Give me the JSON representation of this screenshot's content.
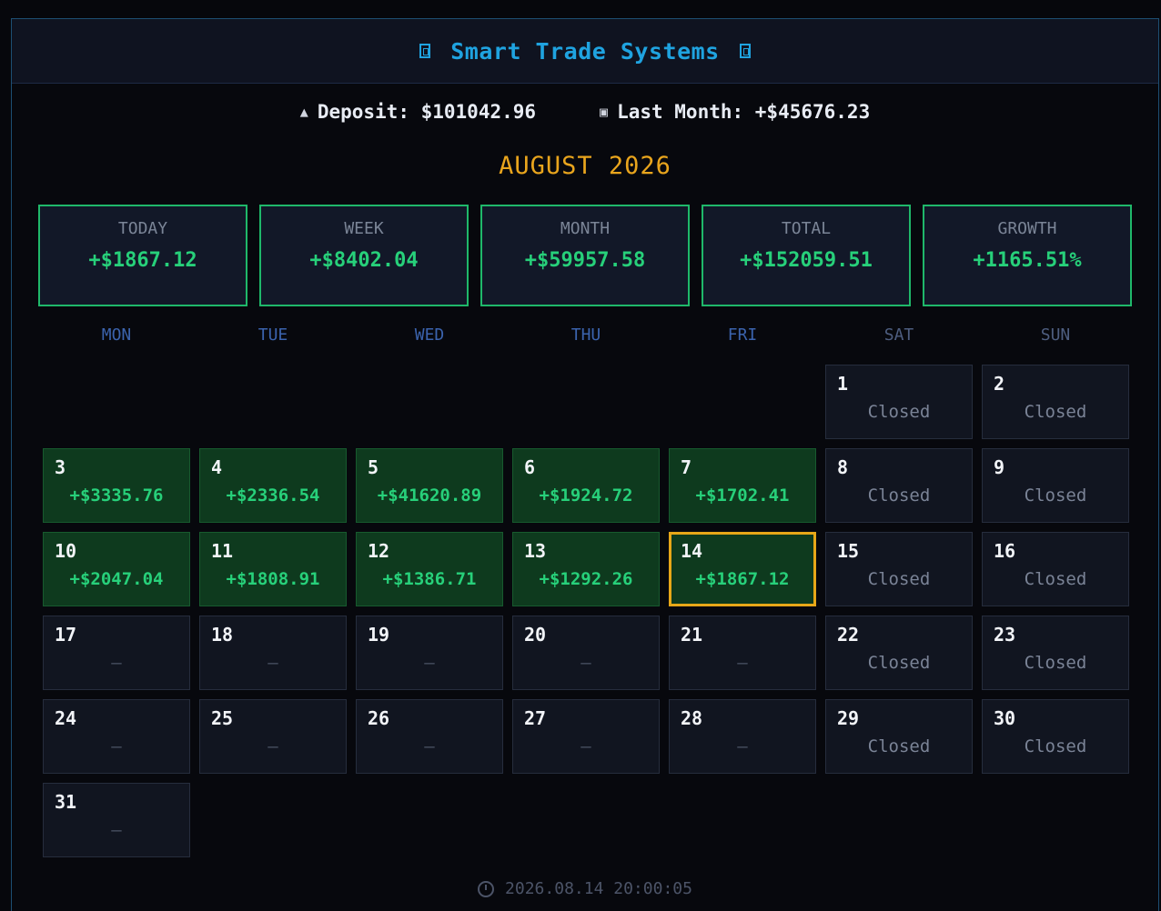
{
  "header": {
    "title": "Smart Trade Systems"
  },
  "info": {
    "deposit_icon": "money-bag-icon",
    "deposit": "Deposit: $101042.96",
    "last_month_icon": "calendar-icon",
    "last_month": "Last Month: +$45676.23"
  },
  "calendar": {
    "month_title": "AUGUST 2026",
    "weekdays": [
      "MON",
      "TUE",
      "WED",
      "THU",
      "FRI",
      "SAT",
      "SUN"
    ]
  },
  "stats": [
    {
      "label": "TODAY",
      "value": "+$1867.12"
    },
    {
      "label": "WEEK",
      "value": "+$8402.04"
    },
    {
      "label": "MONTH",
      "value": "+$59957.58"
    },
    {
      "label": "TOTAL",
      "value": "+$152059.51"
    },
    {
      "label": "GROWTH",
      "value": "+1165.51%"
    }
  ],
  "days": [
    {
      "day": "1",
      "value": "Closed",
      "status": "closed"
    },
    {
      "day": "2",
      "value": "Closed",
      "status": "closed"
    },
    {
      "day": "3",
      "value": "+$3335.76",
      "status": "profit"
    },
    {
      "day": "4",
      "value": "+$2336.54",
      "status": "profit"
    },
    {
      "day": "5",
      "value": "+$41620.89",
      "status": "profit"
    },
    {
      "day": "6",
      "value": "+$1924.72",
      "status": "profit"
    },
    {
      "day": "7",
      "value": "+$1702.41",
      "status": "profit"
    },
    {
      "day": "8",
      "value": "Closed",
      "status": "closed"
    },
    {
      "day": "9",
      "value": "Closed",
      "status": "closed"
    },
    {
      "day": "10",
      "value": "+$2047.04",
      "status": "profit"
    },
    {
      "day": "11",
      "value": "+$1808.91",
      "status": "profit"
    },
    {
      "day": "12",
      "value": "+$1386.71",
      "status": "profit"
    },
    {
      "day": "13",
      "value": "+$1292.26",
      "status": "profit"
    },
    {
      "day": "14",
      "value": "+$1867.12",
      "status": "today"
    },
    {
      "day": "15",
      "value": "Closed",
      "status": "closed"
    },
    {
      "day": "16",
      "value": "Closed",
      "status": "closed"
    },
    {
      "day": "17",
      "value": "—",
      "status": "future"
    },
    {
      "day": "18",
      "value": "—",
      "status": "future"
    },
    {
      "day": "19",
      "value": "—",
      "status": "future"
    },
    {
      "day": "20",
      "value": "—",
      "status": "future"
    },
    {
      "day": "21",
      "value": "—",
      "status": "future"
    },
    {
      "day": "22",
      "value": "Closed",
      "status": "closed"
    },
    {
      "day": "23",
      "value": "Closed",
      "status": "closed"
    },
    {
      "day": "24",
      "value": "—",
      "status": "future"
    },
    {
      "day": "25",
      "value": "—",
      "status": "future"
    },
    {
      "day": "26",
      "value": "—",
      "status": "future"
    },
    {
      "day": "27",
      "value": "—",
      "status": "future"
    },
    {
      "day": "28",
      "value": "—",
      "status": "future"
    },
    {
      "day": "29",
      "value": "Closed",
      "status": "closed"
    },
    {
      "day": "30",
      "value": "Closed",
      "status": "closed"
    },
    {
      "day": "31",
      "value": "—",
      "status": "future"
    }
  ],
  "footer": {
    "timestamp": "2026.08.14 20:00:05"
  }
}
